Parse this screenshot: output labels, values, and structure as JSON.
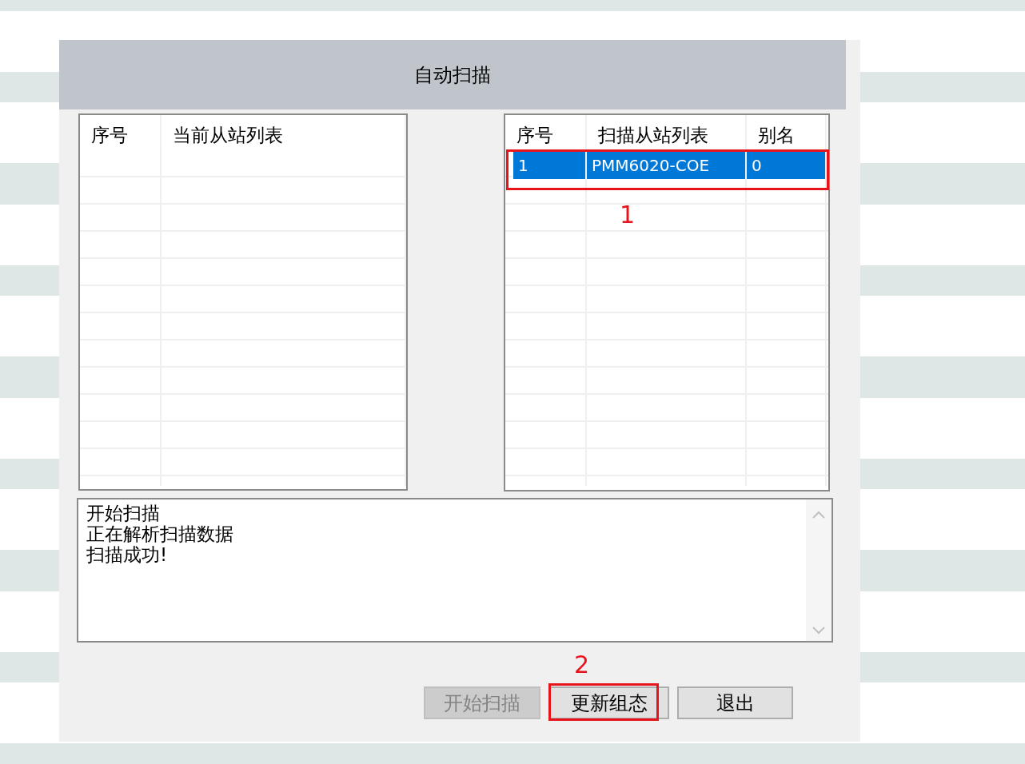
{
  "dialog": {
    "title": "自动扫描"
  },
  "current_table": {
    "columns": [
      "序号",
      "当前从站列表"
    ]
  },
  "scan_table": {
    "columns": [
      "序号",
      "扫描从站列表",
      "别名"
    ],
    "rows": [
      {
        "cells": [
          "1",
          "PMM6020-COE",
          "0"
        ],
        "selected": true
      }
    ]
  },
  "log": {
    "lines": [
      "开始扫描",
      "正在解析扫描数据",
      "扫描成功!"
    ]
  },
  "buttons": [
    {
      "label": "开始扫描",
      "disabled": true
    },
    {
      "label": "更新组态",
      "disabled": false
    },
    {
      "label": "退出",
      "disabled": false
    }
  ],
  "annotations": [
    {
      "label": "1"
    },
    {
      "label": "2"
    }
  ]
}
